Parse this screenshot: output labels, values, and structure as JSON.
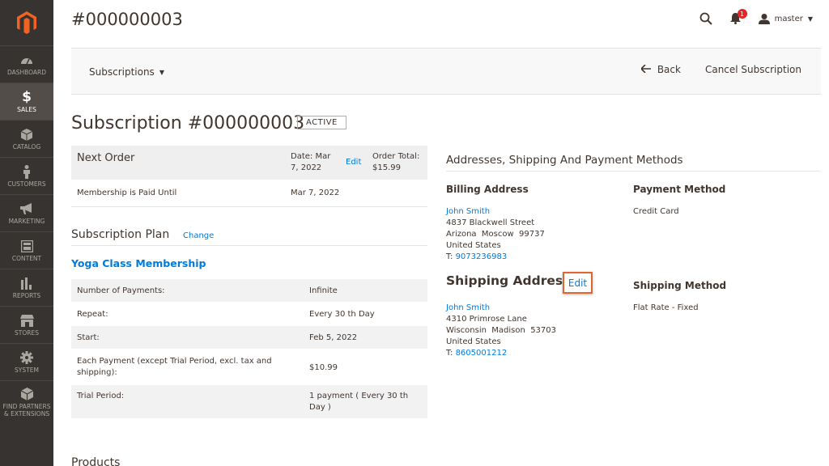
{
  "header": {
    "title": "#000000003",
    "notifications_count": "1",
    "username": "master"
  },
  "sidebar": {
    "items": [
      {
        "label": "Dashboard",
        "icon": "dashboard-icon"
      },
      {
        "label": "Sales",
        "icon": "dollar-icon"
      },
      {
        "label": "Catalog",
        "icon": "box-icon"
      },
      {
        "label": "Customers",
        "icon": "person-icon"
      },
      {
        "label": "Marketing",
        "icon": "megaphone-icon"
      },
      {
        "label": "Content",
        "icon": "layout-icon"
      },
      {
        "label": "Reports",
        "icon": "bar-chart-icon"
      },
      {
        "label": "Stores",
        "icon": "store-icon"
      },
      {
        "label": "System",
        "icon": "gear-icon"
      },
      {
        "label": "Find Partners & Extensions",
        "icon": "cube-icon"
      }
    ]
  },
  "toolbar": {
    "switcher_label": "Subscriptions",
    "back_label": "Back",
    "cancel_label": "Cancel Subscription"
  },
  "subscription": {
    "title": "Subscription #000000003",
    "status": "ACTIVE"
  },
  "next_order": {
    "title": "Next Order",
    "date_label": "Date: Mar",
    "date_value": "7, 2022",
    "edit_label": "Edit",
    "total_label": "Order Total:",
    "total_value": "$15.99",
    "paid_until_label": "Membership is Paid Until",
    "paid_until_value": "Mar 7, 2022"
  },
  "plan": {
    "title": "Subscription Plan",
    "change_label": "Change",
    "name": "Yoga Class Membership",
    "rows": [
      {
        "label": "Number of Payments:",
        "value": "Infinite"
      },
      {
        "label": "Repeat:",
        "value": "Every 30 th Day"
      },
      {
        "label": "Start:",
        "value": "Feb 5, 2022"
      },
      {
        "label": "Each Payment (except Trial Period, excl. tax and shipping):",
        "value": "$10.99"
      },
      {
        "label": "Trial Period:",
        "value": "1 payment ( Every 30 th Day )"
      }
    ]
  },
  "addresses": {
    "title": "Addresses, Shipping And Payment Methods",
    "billing": {
      "title": "Billing Address",
      "name": "John Smith",
      "street": "4837 Blackwell Street",
      "city_line": "Arizona  Moscow  99737",
      "country": "United States",
      "phone_prefix": "T: ",
      "phone": "9073236983"
    },
    "payment": {
      "title": "Payment Method",
      "value": "Credit Card"
    },
    "shipping": {
      "title": "Shipping Address",
      "edit_label": "Edit",
      "name": "John Smith",
      "street": "4310 Primrose Lane",
      "city_line": "Wisconsin  Madison  53703",
      "country": "United States",
      "phone_prefix": "T: ",
      "phone": "8605001212"
    },
    "shipping_method": {
      "title": "Shipping Method",
      "value": "Flat Rate - Fixed"
    }
  },
  "products": {
    "title": "Products"
  },
  "colors": {
    "sidebar_bg": "#373330",
    "link": "#007bdb",
    "highlight": "#e0652e",
    "logo": "#f26322"
  }
}
